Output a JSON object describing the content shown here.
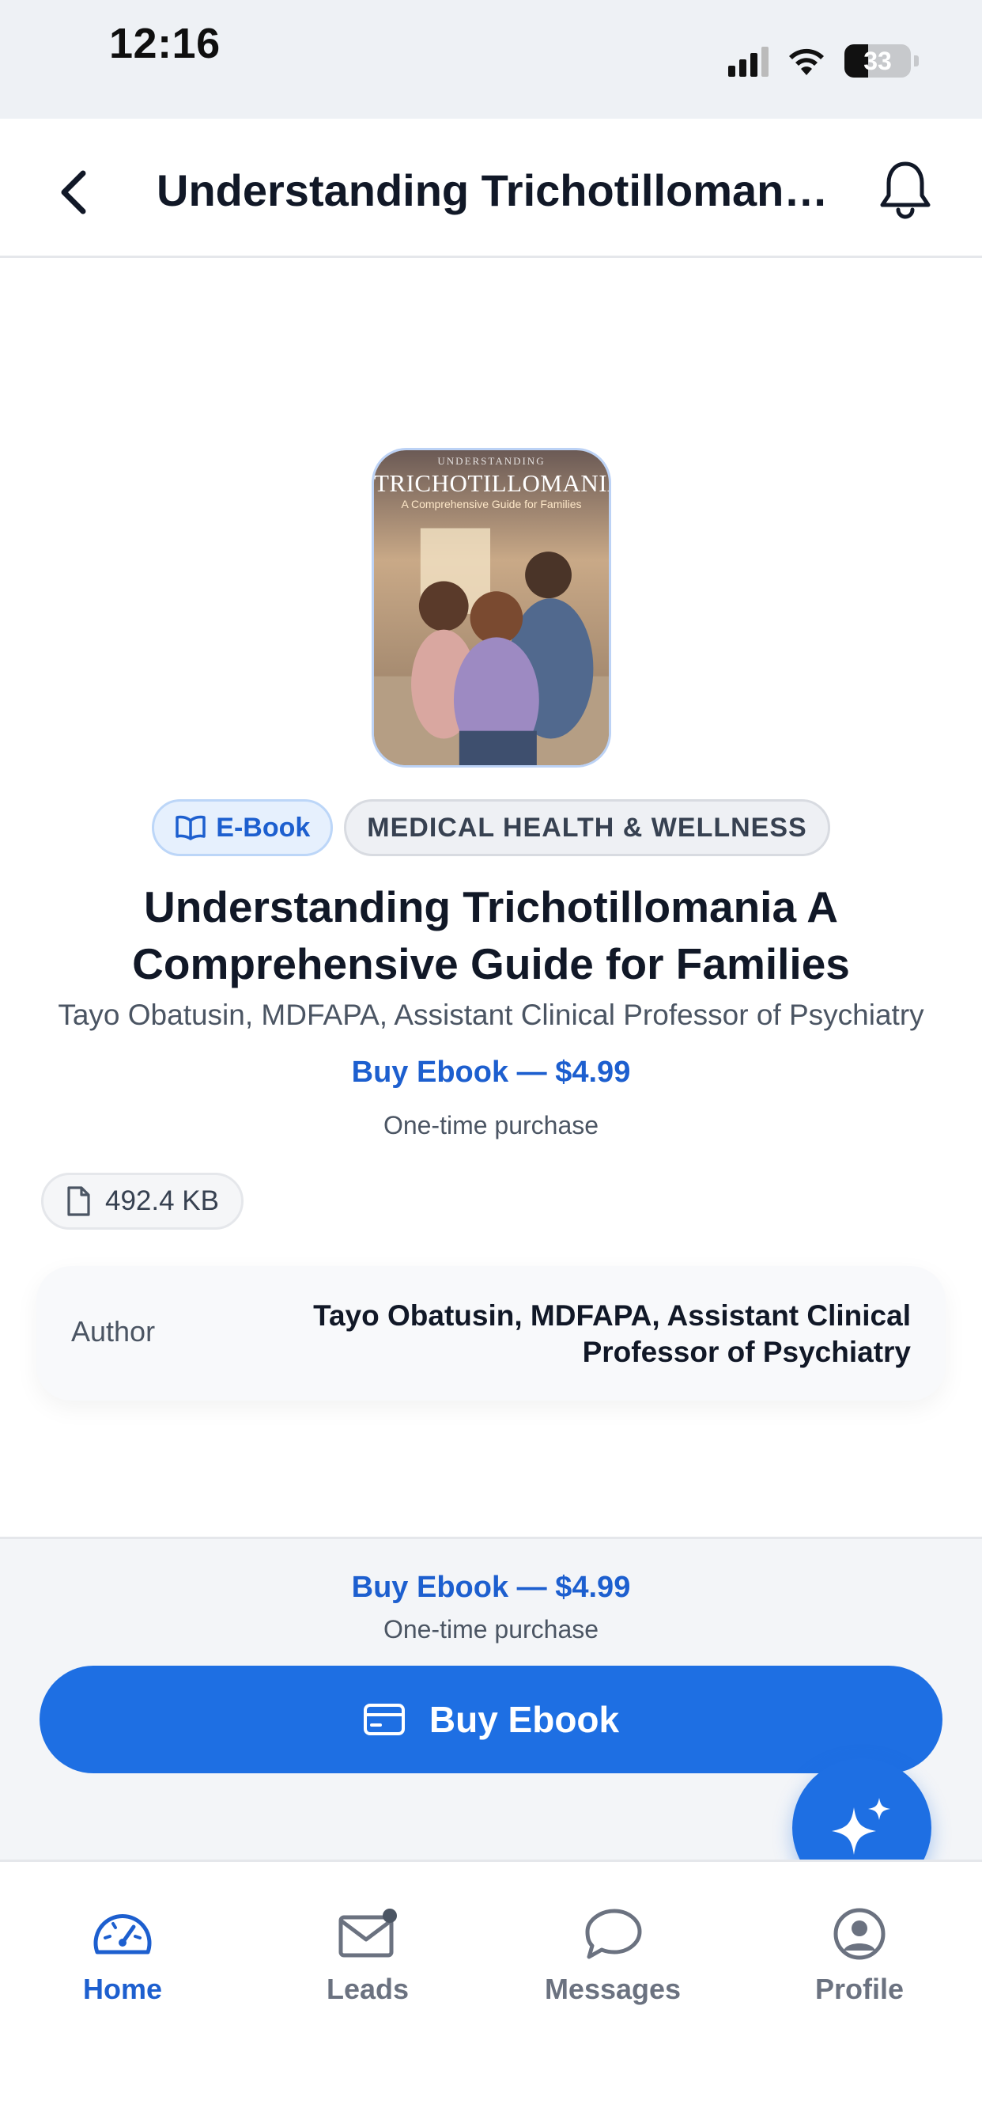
{
  "status_bar": {
    "time": "12:16",
    "battery": "33"
  },
  "header": {
    "title": "Understanding Trichotillomania A Comprehensive Guide for Families"
  },
  "cover": {
    "overline": "UNDERSTANDING",
    "title": "TRICHOTILLOMANIA",
    "subtitle": "A Comprehensive Guide for Families"
  },
  "chips": {
    "format": "E-Book",
    "category": "MEDICAL HEALTH & WELLNESS"
  },
  "book": {
    "title": "Understanding Trichotillomania A Comprehensive Guide for Families",
    "author": "Tayo Obatusin, MDFAPA, Assistant Clinical Professor of Psychiatry",
    "price_label": "Buy Ebook — $4.99",
    "price_note": "One-time purchase",
    "file_size": "492.4 KB"
  },
  "meta": {
    "author_label": "Author",
    "author_value": "Tayo Obatusin, MDFAPA, Assistant Clinical Professor of Psychiatry"
  },
  "buy_panel": {
    "price_label": "Buy Ebook — $4.99",
    "price_note": "One-time purchase",
    "button_label": "Buy Ebook"
  },
  "tabs": [
    {
      "label": "Home",
      "icon": "gauge-icon",
      "active": true
    },
    {
      "label": "Leads",
      "icon": "mail-icon",
      "active": false
    },
    {
      "label": "Messages",
      "icon": "chat-bubble-icon",
      "active": false
    },
    {
      "label": "Profile",
      "icon": "user-circle-icon",
      "active": false
    }
  ],
  "colors": {
    "accent": "#1e6fe3",
    "accent_text": "#1d5fcf",
    "chip_ebook_bg": "#e6f0fd"
  }
}
